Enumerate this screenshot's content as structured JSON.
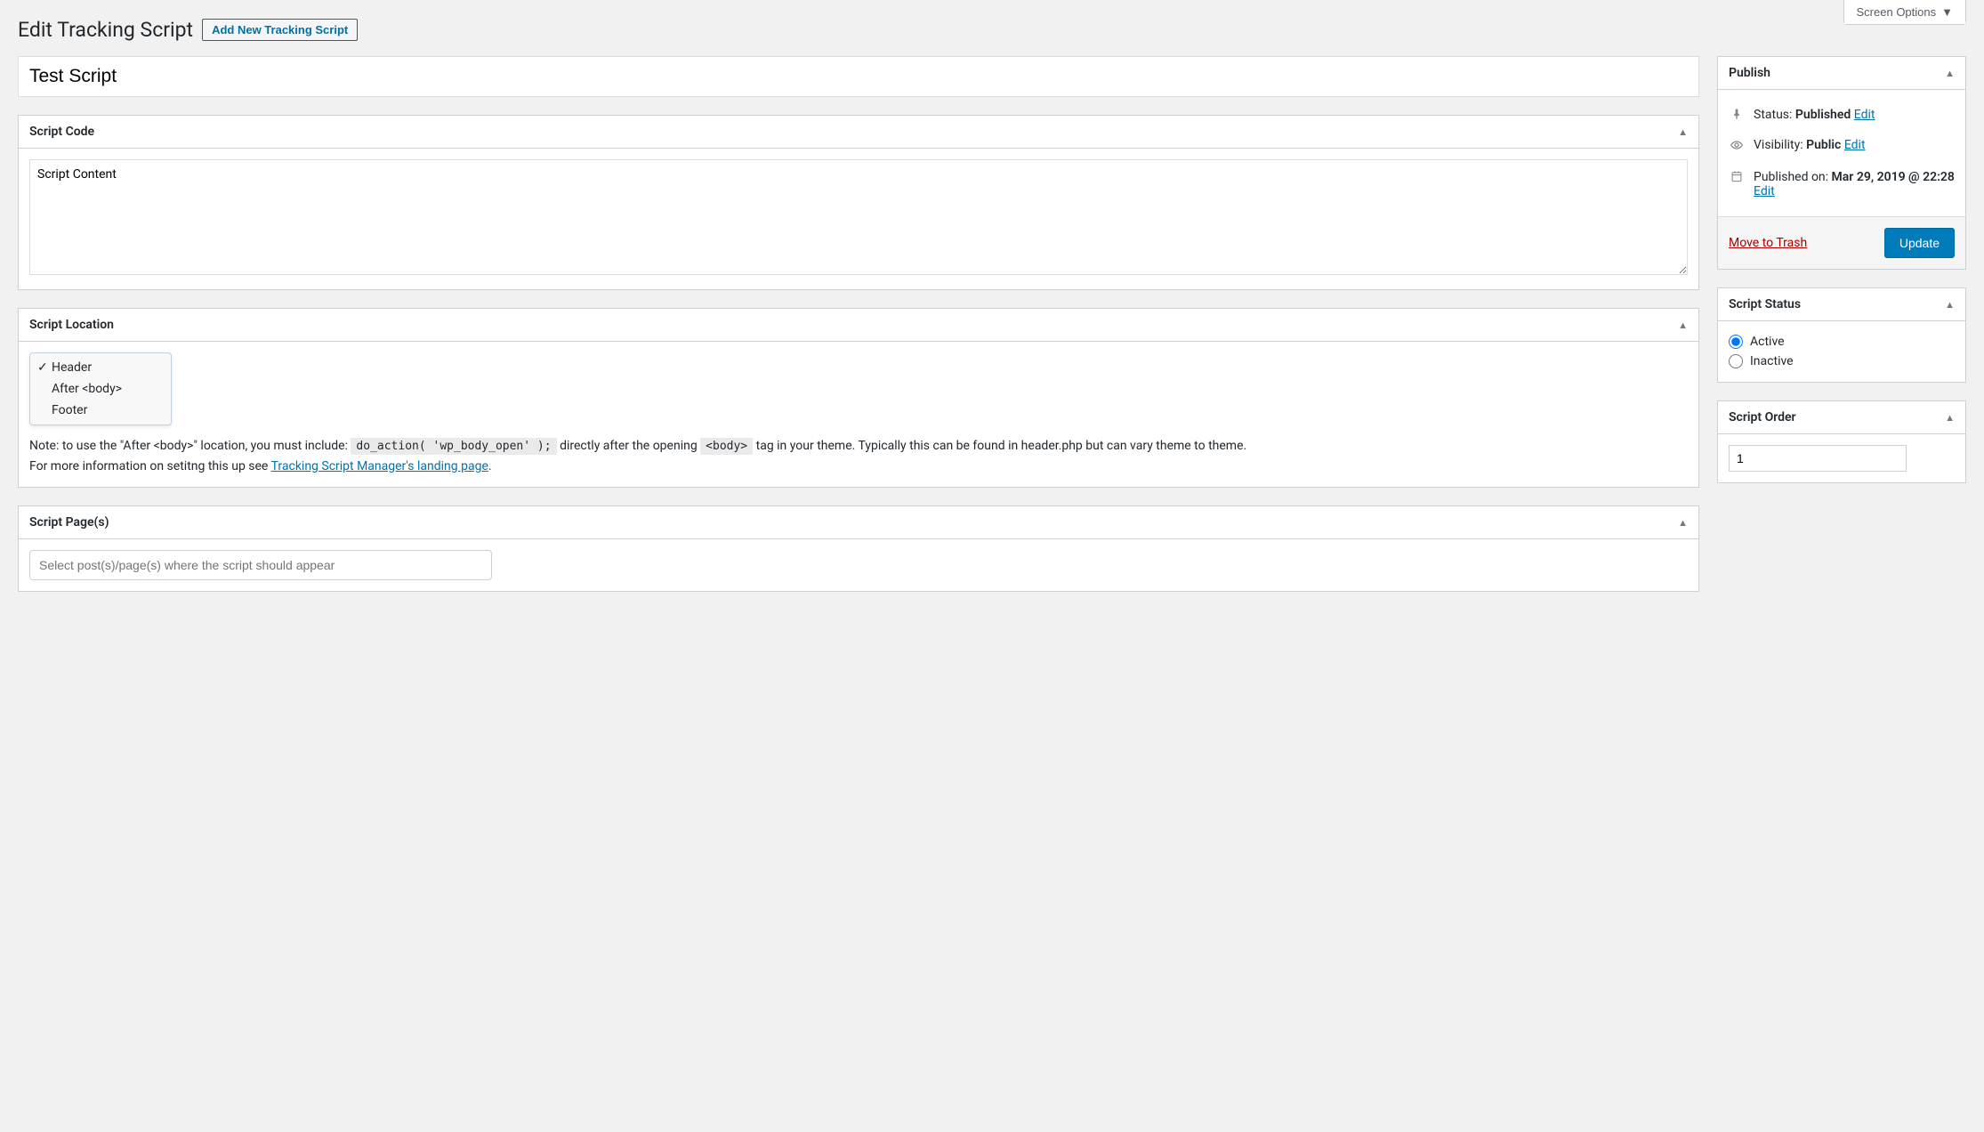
{
  "screen_options_label": "Screen Options",
  "page_title": "Edit Tracking Script",
  "add_new_label": "Add New Tracking Script",
  "title_value": "Test Script",
  "script_code": {
    "heading": "Script Code",
    "content": "Script Content"
  },
  "script_location": {
    "heading": "Script Location",
    "options": [
      "Header",
      "After <body>",
      "Footer"
    ],
    "selected_index": 0,
    "note_prefix": "Note: to use the \"After <body>\" location, you must include: ",
    "code_snippet": "do_action( 'wp_body_open' );",
    "note_mid": " directly after the opening ",
    "body_tag_code": "<body>",
    "note_after_body": " tag in your theme. Typically this can be found in header.php but can vary theme to theme.",
    "note_line2_prefix": "For more information on setitng this up see ",
    "link_text": "Tracking Script Manager's landing page",
    "note_period": "."
  },
  "script_pages": {
    "heading": "Script Page(s)",
    "placeholder": "Select post(s)/page(s) where the script should appear"
  },
  "publish": {
    "heading": "Publish",
    "status_label": "Status: ",
    "status_value": "Published",
    "visibility_label": "Visibility: ",
    "visibility_value": "Public",
    "published_label": "Published on: ",
    "published_value": "Mar 29, 2019 @ 22:28",
    "edit_label": "Edit",
    "trash_label": "Move to Trash",
    "update_label": "Update"
  },
  "script_status": {
    "heading": "Script Status",
    "active_label": "Active",
    "inactive_label": "Inactive",
    "selected": "active"
  },
  "script_order": {
    "heading": "Script Order",
    "value": "1"
  }
}
